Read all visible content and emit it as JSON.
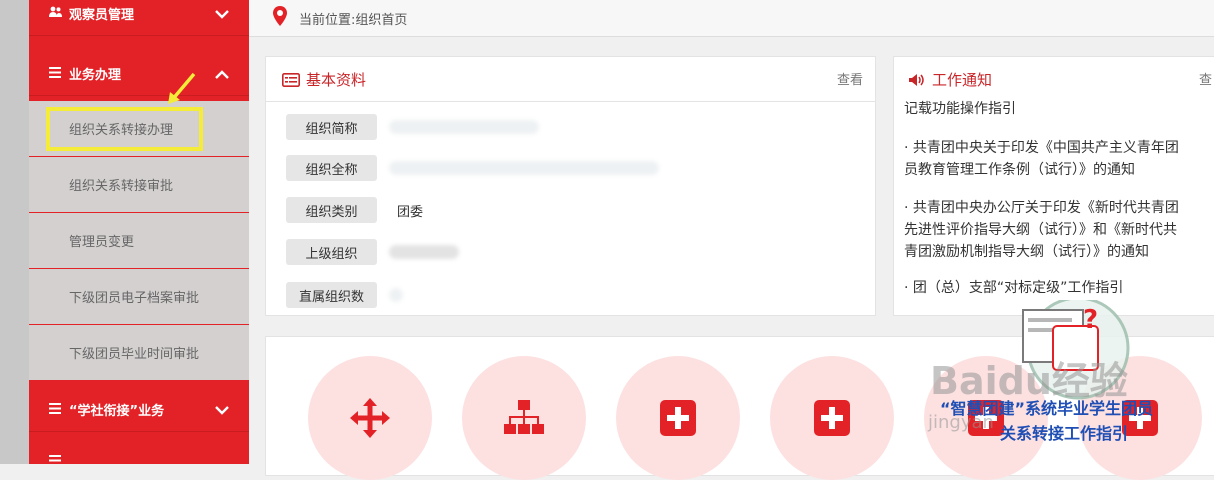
{
  "sidebar": {
    "items": [
      {
        "label": "观察员管理",
        "icon": "users-icon",
        "chevron": "chevron-down-icon"
      },
      {
        "label": "业务办理",
        "icon": "menu-lines-icon",
        "chevron": "chevron-up-icon"
      },
      {
        "label": "“学社衔接”业务",
        "icon": "menu-lines-icon",
        "chevron": "chevron-down-icon"
      }
    ],
    "subitems": [
      {
        "label": "组织关系转接办理"
      },
      {
        "label": "组织关系转接审批"
      },
      {
        "label": "管理员变更"
      },
      {
        "label": "下级团员电子档案审批"
      },
      {
        "label": "下级团员毕业时间审批"
      }
    ]
  },
  "breadcrumb": {
    "text": "当前位置:组织首页"
  },
  "basic_panel": {
    "title": "基本资料",
    "more": "查看",
    "rows": [
      {
        "label": "组织简称",
        "value": ""
      },
      {
        "label": "组织全称",
        "value": ""
      },
      {
        "label": "组织类别",
        "value": "团委"
      },
      {
        "label": "上级组织",
        "value": ""
      },
      {
        "label": "直属组织数",
        "value": ""
      }
    ]
  },
  "notice_panel": {
    "title": "工作通知",
    "more": "查",
    "lines": [
      "记载功能操作指引",
      "· 共青团中央关于印发《中国共产主义青年团",
      "员教育管理工作条例（试行）》的通知",
      "· 共青团中央办公厅关于印发《新时代共青团",
      "先进性评价指导大纲（试行）》和《新时代共",
      "青团激励机制指导大纲（试行）》的通知",
      "· 团（总）支部“对标定级”工作指引"
    ]
  },
  "quick_icons": [
    {
      "icon": "move-arrows-icon"
    },
    {
      "icon": "org-chart-icon"
    },
    {
      "icon": "plus-square-icon"
    },
    {
      "icon": "plus-square-icon"
    },
    {
      "icon": "plus-square-icon"
    },
    {
      "icon": "plus-square-icon"
    }
  ],
  "watermark": {
    "logo_text": "Baidu经验",
    "url_text": "jingyan",
    "caption_line1": "“智慧团建”系统毕业学生团员",
    "caption_line2": "关系转接工作指引"
  },
  "colors": {
    "brand_red": "#e32227",
    "highlight_yellow": "#f5ec3a",
    "circle_pink": "#fde1e1"
  }
}
